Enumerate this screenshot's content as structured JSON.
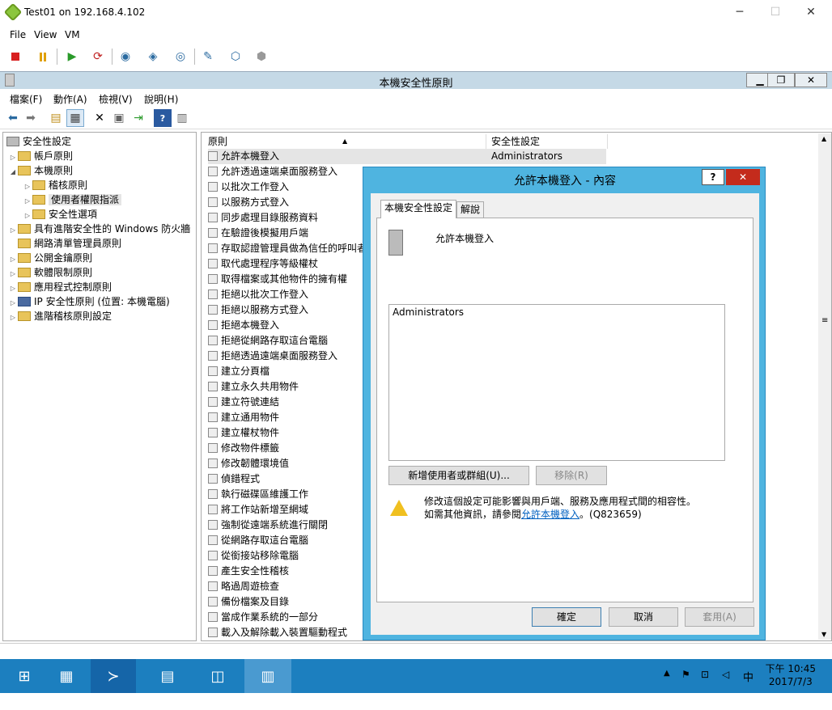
{
  "vm": {
    "title": "Test01 on 192.168.4.102",
    "menu": [
      "File",
      "View",
      "VM"
    ]
  },
  "mmc": {
    "title": "本機安全性原則",
    "menu": [
      "檔案(F)",
      "動作(A)",
      "檢視(V)",
      "說明(H)"
    ]
  },
  "tree": {
    "root": "安全性設定",
    "items": [
      {
        "label": "帳戶原則",
        "arrow": "▷"
      },
      {
        "label": "本機原則",
        "arrow": "◢"
      },
      {
        "label": "稽核原則",
        "arrow": "▷"
      },
      {
        "label": "使用者權限指派",
        "arrow": "▷"
      },
      {
        "label": "安全性選項",
        "arrow": "▷"
      },
      {
        "label": "具有進階安全性的 Windows 防火牆",
        "arrow": "▷"
      },
      {
        "label": "網路清單管理員原則",
        "arrow": ""
      },
      {
        "label": "公開金鑰原則",
        "arrow": "▷"
      },
      {
        "label": "軟體限制原則",
        "arrow": "▷"
      },
      {
        "label": "應用程式控制原則",
        "arrow": "▷"
      },
      {
        "label": "IP 安全性原則 (位置: 本機電腦)",
        "arrow": "▷"
      },
      {
        "label": "進階稽核原則設定",
        "arrow": "▷"
      }
    ]
  },
  "list": {
    "col_policy": "原則",
    "col_setting": "安全性設定",
    "rows": [
      {
        "policy": "允許本機登入",
        "setting": "Administrators"
      },
      {
        "policy": "允許透過遠端桌面服務登入"
      },
      {
        "policy": "以批次工作登入"
      },
      {
        "policy": "以服務方式登入"
      },
      {
        "policy": "同步處理目錄服務資料"
      },
      {
        "policy": "在驗證後模擬用戶端"
      },
      {
        "policy": "存取認證管理員做為信任的呼叫者"
      },
      {
        "policy": "取代處理程序等級權杖"
      },
      {
        "policy": "取得檔案或其他物件的擁有權"
      },
      {
        "policy": "拒絕以批次工作登入"
      },
      {
        "policy": "拒絕以服務方式登入"
      },
      {
        "policy": "拒絕本機登入"
      },
      {
        "policy": "拒絕從網路存取這台電腦"
      },
      {
        "policy": "拒絕透過遠端桌面服務登入"
      },
      {
        "policy": "建立分頁檔"
      },
      {
        "policy": "建立永久共用物件"
      },
      {
        "policy": "建立符號連結"
      },
      {
        "policy": "建立通用物件"
      },
      {
        "policy": "建立權杖物件"
      },
      {
        "policy": "修改物件標籤"
      },
      {
        "policy": "修改韌體環境值"
      },
      {
        "policy": "偵錯程式"
      },
      {
        "policy": "執行磁碟區維護工作"
      },
      {
        "policy": "將工作站新增至網域"
      },
      {
        "policy": "強制從遠端系統進行關閉"
      },
      {
        "policy": "從網路存取這台電腦"
      },
      {
        "policy": "從銜接站移除電腦"
      },
      {
        "policy": "產生安全性稽核"
      },
      {
        "policy": "略過周遊檢查"
      },
      {
        "policy": "備份檔案及目錄"
      },
      {
        "policy": "當成作業系統的一部分"
      },
      {
        "policy": "載入及解除載入裝置驅動程式"
      }
    ]
  },
  "dialog": {
    "title": "允許本機登入 - 內容",
    "help": "?",
    "close": "✕",
    "tab_local": "本機安全性設定",
    "tab_explain": "解說",
    "policy_name": "允許本機登入",
    "members": [
      "Administrators"
    ],
    "add_btn": "新增使用者或群組(U)...",
    "remove_btn": "移除(R)",
    "warning_line1": "修改這個設定可能影響與用戶端、服務及應用程式間的相容性。",
    "warning_line2_pre": "如需其他資訊，請參閱",
    "warning_link": "允許本機登入",
    "warning_line2_post": "。(Q823659)",
    "ok": "確定",
    "cancel": "取消",
    "apply": "套用(A)"
  },
  "taskbar": {
    "time": "下午 10:45",
    "date": "2017/7/3",
    "ime": "中"
  }
}
